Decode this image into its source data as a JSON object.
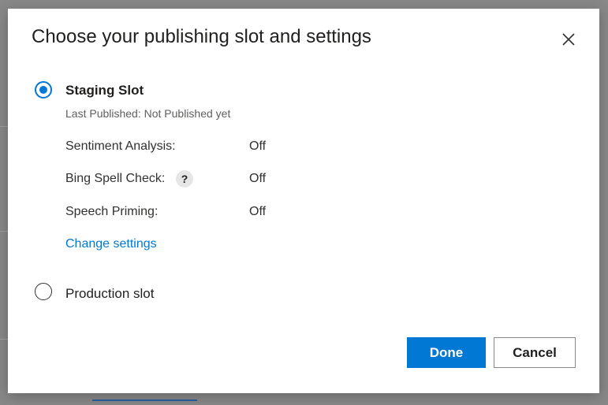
{
  "dialog": {
    "title": "Choose your publishing slot and settings",
    "close_icon": "close-icon"
  },
  "staging_slot": {
    "label": "Staging Slot",
    "selected": true,
    "last_published": "Last Published: Not Published yet",
    "settings": [
      {
        "label": "Sentiment Analysis:",
        "value": "Off"
      },
      {
        "label": "Bing Spell Check:",
        "value": "Off",
        "help": "?"
      },
      {
        "label": "Speech Priming:",
        "value": "Off"
      }
    ],
    "change_settings_link": "Change settings"
  },
  "production_slot": {
    "label": "Production slot",
    "selected": false
  },
  "buttons": {
    "done": "Done",
    "cancel": "Cancel"
  },
  "colors": {
    "accent": "#0078d4",
    "overlay": "#888888"
  }
}
